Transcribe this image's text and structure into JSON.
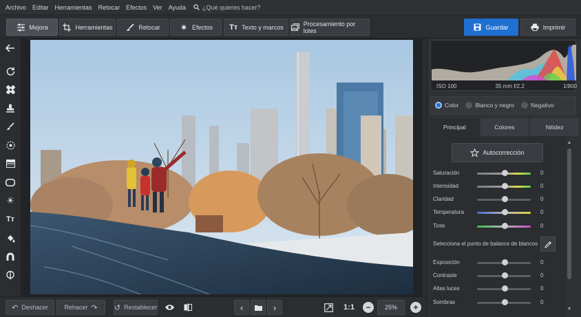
{
  "menu": [
    "Archivo",
    "Editar",
    "Herramientas",
    "Retocar",
    "Efectos",
    "Ver",
    "Ayuda"
  ],
  "search": {
    "placeholder": "¿Qué quieres hacer?",
    "icon": "search-icon"
  },
  "toolbar": {
    "tools": [
      {
        "label": "Mejora",
        "icon": "sliders-icon",
        "active": true
      },
      {
        "label": "Herramientas",
        "icon": "crop-icon",
        "active": false
      },
      {
        "label": "Retocar",
        "icon": "brush-icon",
        "active": false
      },
      {
        "label": "Efectos",
        "icon": "sparkle-icon",
        "active": false
      },
      {
        "label": "Texto y marcos",
        "icon": "text-icon",
        "active": false
      },
      {
        "label": "Procesamiento por lotes",
        "icon": "batch-icon",
        "active": false
      }
    ],
    "save_label": "Guardar",
    "print_label": "Imprimir"
  },
  "left_tools": [
    "back-arrow-icon",
    "rotate-icon",
    "bandage-icon",
    "stamp-icon",
    "brush-icon",
    "radial-filter-icon",
    "gradient-filter-icon",
    "vignette-icon",
    "light-icon",
    "text-icon",
    "fill-icon",
    "magnet-icon",
    "shield-icon"
  ],
  "histogram": {
    "iso": "ISO 100",
    "lens": "35 mm f/2.2",
    "shutter": "1/800"
  },
  "color_modes": {
    "options": [
      "Color",
      "Blanco y negro",
      "Negativo"
    ],
    "selected": "Color"
  },
  "tabs": {
    "items": [
      "Principal",
      "Colores",
      "Nitidez"
    ],
    "active": "Principal"
  },
  "panel": {
    "auto_label": "Autocorrección",
    "sliders_a": [
      {
        "label": "Saturación",
        "value": "0",
        "gradient": [
          "#7a7d84",
          "#9ba0a8",
          "#e0da4a",
          "#5fcf4f"
        ]
      },
      {
        "label": "Intensidad",
        "value": "0",
        "gradient": [
          "#7a7d84",
          "#9ba0a8",
          "#e0da4a",
          "#5fcf4f"
        ]
      },
      {
        "label": "Claridad",
        "value": "0",
        "gradient": [
          "#5b5e64",
          "#5b5e64"
        ]
      },
      {
        "label": "Temperatura",
        "value": "0",
        "gradient": [
          "#4a6bd8",
          "#b5b7bb",
          "#e2d23a"
        ]
      },
      {
        "label": "Tinte",
        "value": "0",
        "gradient": [
          "#3dbb4d",
          "#b5b7bb",
          "#c64fc6"
        ]
      }
    ],
    "wb_label": "Selecciona el punto de balance de blancos",
    "sliders_b": [
      {
        "label": "Exposición",
        "value": "0"
      },
      {
        "label": "Contraste",
        "value": "0"
      },
      {
        "label": "Altas luces",
        "value": "0"
      },
      {
        "label": "Sombras",
        "value": "0"
      }
    ]
  },
  "bottom": {
    "undo_label": "Deshacer",
    "redo_label": "Rehacer",
    "reset_label": "Restablecer",
    "ratio_label": "1:1",
    "zoom_value": "25%"
  }
}
